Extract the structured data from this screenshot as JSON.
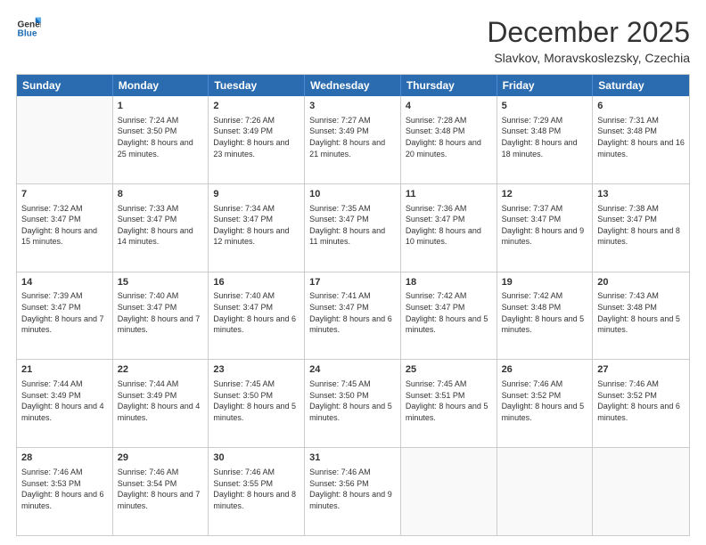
{
  "logo": {
    "line1": "General",
    "line2": "Blue"
  },
  "header": {
    "month": "December 2025",
    "location": "Slavkov, Moravskoslezsky, Czechia"
  },
  "weekdays": [
    "Sunday",
    "Monday",
    "Tuesday",
    "Wednesday",
    "Thursday",
    "Friday",
    "Saturday"
  ],
  "rows": [
    [
      {
        "day": "",
        "sunrise": "",
        "sunset": "",
        "daylight": ""
      },
      {
        "day": "1",
        "sunrise": "Sunrise: 7:24 AM",
        "sunset": "Sunset: 3:50 PM",
        "daylight": "Daylight: 8 hours and 25 minutes."
      },
      {
        "day": "2",
        "sunrise": "Sunrise: 7:26 AM",
        "sunset": "Sunset: 3:49 PM",
        "daylight": "Daylight: 8 hours and 23 minutes."
      },
      {
        "day": "3",
        "sunrise": "Sunrise: 7:27 AM",
        "sunset": "Sunset: 3:49 PM",
        "daylight": "Daylight: 8 hours and 21 minutes."
      },
      {
        "day": "4",
        "sunrise": "Sunrise: 7:28 AM",
        "sunset": "Sunset: 3:48 PM",
        "daylight": "Daylight: 8 hours and 20 minutes."
      },
      {
        "day": "5",
        "sunrise": "Sunrise: 7:29 AM",
        "sunset": "Sunset: 3:48 PM",
        "daylight": "Daylight: 8 hours and 18 minutes."
      },
      {
        "day": "6",
        "sunrise": "Sunrise: 7:31 AM",
        "sunset": "Sunset: 3:48 PM",
        "daylight": "Daylight: 8 hours and 16 minutes."
      }
    ],
    [
      {
        "day": "7",
        "sunrise": "Sunrise: 7:32 AM",
        "sunset": "Sunset: 3:47 PM",
        "daylight": "Daylight: 8 hours and 15 minutes."
      },
      {
        "day": "8",
        "sunrise": "Sunrise: 7:33 AM",
        "sunset": "Sunset: 3:47 PM",
        "daylight": "Daylight: 8 hours and 14 minutes."
      },
      {
        "day": "9",
        "sunrise": "Sunrise: 7:34 AM",
        "sunset": "Sunset: 3:47 PM",
        "daylight": "Daylight: 8 hours and 12 minutes."
      },
      {
        "day": "10",
        "sunrise": "Sunrise: 7:35 AM",
        "sunset": "Sunset: 3:47 PM",
        "daylight": "Daylight: 8 hours and 11 minutes."
      },
      {
        "day": "11",
        "sunrise": "Sunrise: 7:36 AM",
        "sunset": "Sunset: 3:47 PM",
        "daylight": "Daylight: 8 hours and 10 minutes."
      },
      {
        "day": "12",
        "sunrise": "Sunrise: 7:37 AM",
        "sunset": "Sunset: 3:47 PM",
        "daylight": "Daylight: 8 hours and 9 minutes."
      },
      {
        "day": "13",
        "sunrise": "Sunrise: 7:38 AM",
        "sunset": "Sunset: 3:47 PM",
        "daylight": "Daylight: 8 hours and 8 minutes."
      }
    ],
    [
      {
        "day": "14",
        "sunrise": "Sunrise: 7:39 AM",
        "sunset": "Sunset: 3:47 PM",
        "daylight": "Daylight: 8 hours and 7 minutes."
      },
      {
        "day": "15",
        "sunrise": "Sunrise: 7:40 AM",
        "sunset": "Sunset: 3:47 PM",
        "daylight": "Daylight: 8 hours and 7 minutes."
      },
      {
        "day": "16",
        "sunrise": "Sunrise: 7:40 AM",
        "sunset": "Sunset: 3:47 PM",
        "daylight": "Daylight: 8 hours and 6 minutes."
      },
      {
        "day": "17",
        "sunrise": "Sunrise: 7:41 AM",
        "sunset": "Sunset: 3:47 PM",
        "daylight": "Daylight: 8 hours and 6 minutes."
      },
      {
        "day": "18",
        "sunrise": "Sunrise: 7:42 AM",
        "sunset": "Sunset: 3:47 PM",
        "daylight": "Daylight: 8 hours and 5 minutes."
      },
      {
        "day": "19",
        "sunrise": "Sunrise: 7:42 AM",
        "sunset": "Sunset: 3:48 PM",
        "daylight": "Daylight: 8 hours and 5 minutes."
      },
      {
        "day": "20",
        "sunrise": "Sunrise: 7:43 AM",
        "sunset": "Sunset: 3:48 PM",
        "daylight": "Daylight: 8 hours and 5 minutes."
      }
    ],
    [
      {
        "day": "21",
        "sunrise": "Sunrise: 7:44 AM",
        "sunset": "Sunset: 3:49 PM",
        "daylight": "Daylight: 8 hours and 4 minutes."
      },
      {
        "day": "22",
        "sunrise": "Sunrise: 7:44 AM",
        "sunset": "Sunset: 3:49 PM",
        "daylight": "Daylight: 8 hours and 4 minutes."
      },
      {
        "day": "23",
        "sunrise": "Sunrise: 7:45 AM",
        "sunset": "Sunset: 3:50 PM",
        "daylight": "Daylight: 8 hours and 5 minutes."
      },
      {
        "day": "24",
        "sunrise": "Sunrise: 7:45 AM",
        "sunset": "Sunset: 3:50 PM",
        "daylight": "Daylight: 8 hours and 5 minutes."
      },
      {
        "day": "25",
        "sunrise": "Sunrise: 7:45 AM",
        "sunset": "Sunset: 3:51 PM",
        "daylight": "Daylight: 8 hours and 5 minutes."
      },
      {
        "day": "26",
        "sunrise": "Sunrise: 7:46 AM",
        "sunset": "Sunset: 3:52 PM",
        "daylight": "Daylight: 8 hours and 5 minutes."
      },
      {
        "day": "27",
        "sunrise": "Sunrise: 7:46 AM",
        "sunset": "Sunset: 3:52 PM",
        "daylight": "Daylight: 8 hours and 6 minutes."
      }
    ],
    [
      {
        "day": "28",
        "sunrise": "Sunrise: 7:46 AM",
        "sunset": "Sunset: 3:53 PM",
        "daylight": "Daylight: 8 hours and 6 minutes."
      },
      {
        "day": "29",
        "sunrise": "Sunrise: 7:46 AM",
        "sunset": "Sunset: 3:54 PM",
        "daylight": "Daylight: 8 hours and 7 minutes."
      },
      {
        "day": "30",
        "sunrise": "Sunrise: 7:46 AM",
        "sunset": "Sunset: 3:55 PM",
        "daylight": "Daylight: 8 hours and 8 minutes."
      },
      {
        "day": "31",
        "sunrise": "Sunrise: 7:46 AM",
        "sunset": "Sunset: 3:56 PM",
        "daylight": "Daylight: 8 hours and 9 minutes."
      },
      {
        "day": "",
        "sunrise": "",
        "sunset": "",
        "daylight": ""
      },
      {
        "day": "",
        "sunrise": "",
        "sunset": "",
        "daylight": ""
      },
      {
        "day": "",
        "sunrise": "",
        "sunset": "",
        "daylight": ""
      }
    ]
  ]
}
